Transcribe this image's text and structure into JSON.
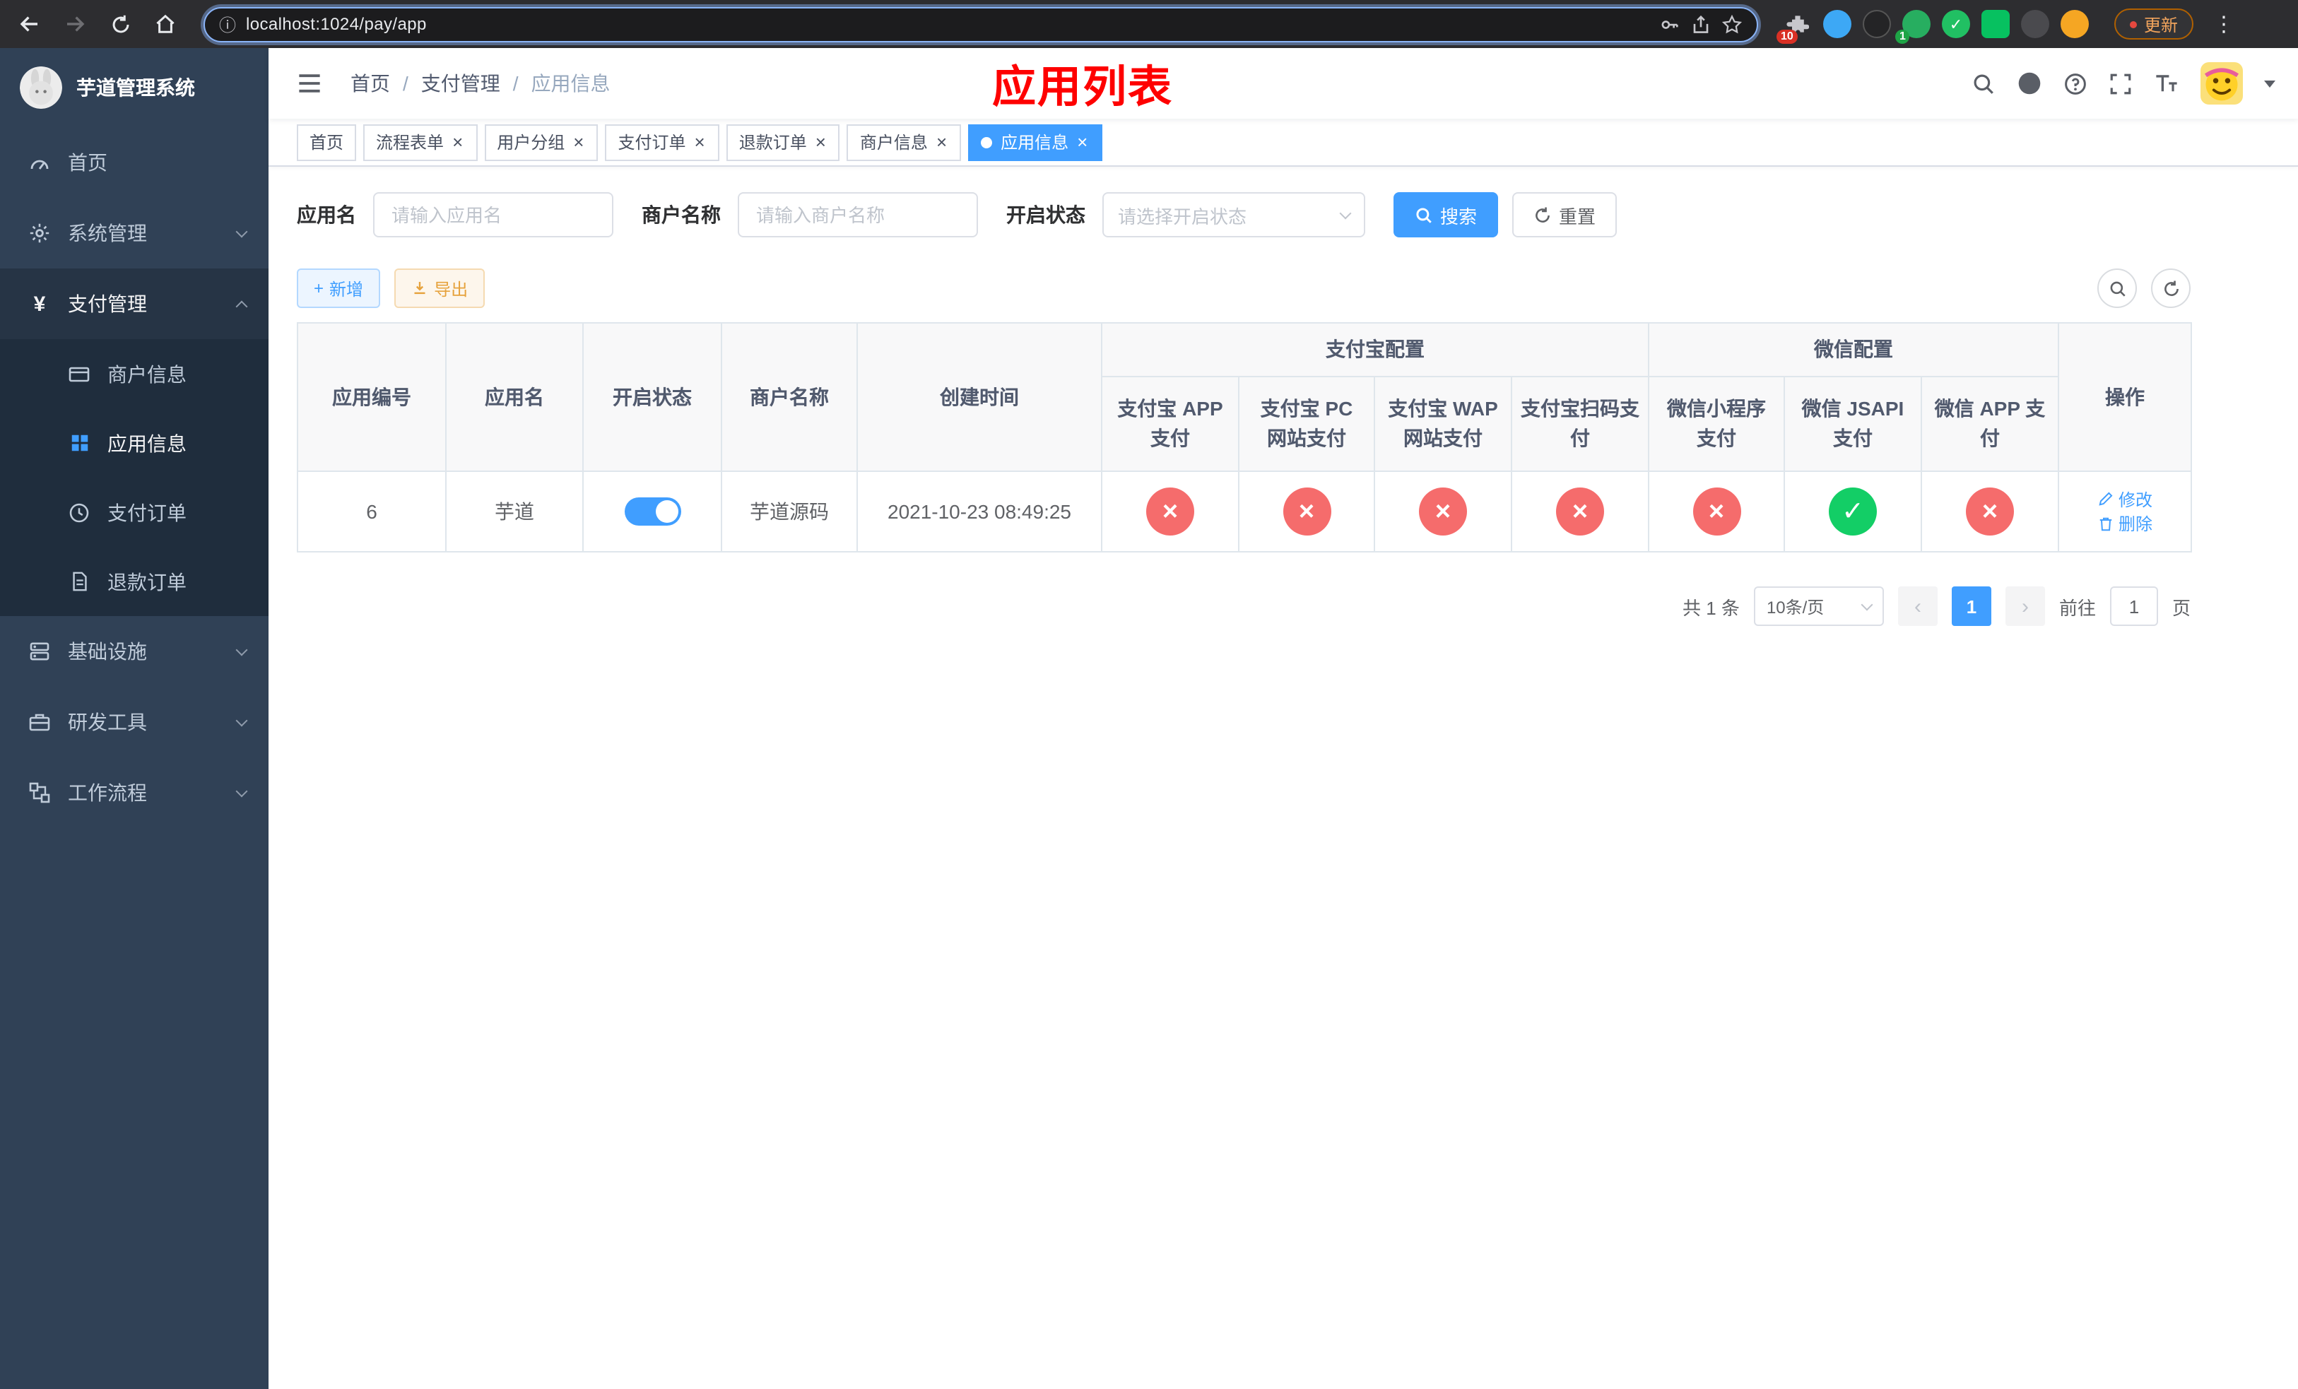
{
  "colors": {
    "primary": "#409eff",
    "success": "#13ce66",
    "danger": "#f56c6c",
    "warning": "#e6a23c",
    "sidebar_bg": "#304156",
    "submenu_bg": "#1f2d3d"
  },
  "icons": {
    "close": "×",
    "check": "✓",
    "cross": "×",
    "prev": "‹",
    "next": "›",
    "more_vertical": "⋮",
    "info": "ⓘ",
    "yen": "¥",
    "plus": "+"
  },
  "browser": {
    "url": "localhost:1024/pay/app",
    "update_label": "更新",
    "extension_badges": [
      "10",
      "1"
    ]
  },
  "sidebar": {
    "app_title": "芋道管理系统",
    "menu": [
      {
        "label": "首页"
      },
      {
        "label": "系统管理"
      },
      {
        "label": "支付管理",
        "children": [
          {
            "label": "商户信息"
          },
          {
            "label": "应用信息"
          },
          {
            "label": "支付订单"
          },
          {
            "label": "退款订单"
          }
        ]
      },
      {
        "label": "基础设施"
      },
      {
        "label": "研发工具"
      },
      {
        "label": "工作流程"
      }
    ]
  },
  "header": {
    "breadcrumb": [
      "首页",
      "支付管理",
      "应用信息"
    ],
    "separator": "/",
    "overlay_title": "应用列表"
  },
  "tabs": [
    {
      "label": "首页"
    },
    {
      "label": "流程表单"
    },
    {
      "label": "用户分组"
    },
    {
      "label": "支付订单"
    },
    {
      "label": "退款订单"
    },
    {
      "label": "商户信息"
    },
    {
      "label": "应用信息"
    }
  ],
  "filters": {
    "app_name": {
      "label": "应用名",
      "placeholder": "请输入应用名",
      "value": ""
    },
    "merchant_name": {
      "label": "商户名称",
      "placeholder": "请输入商户名称",
      "value": ""
    },
    "status": {
      "label": "开启状态",
      "placeholder": "请选择开启状态"
    },
    "search_label": "搜索",
    "reset_label": "重置"
  },
  "toolbar": {
    "add_label": "新增",
    "export_label": "导出"
  },
  "table": {
    "groups": {
      "alipay": "支付宝配置",
      "wechat": "微信配置"
    },
    "columns": [
      "应用编号",
      "应用名",
      "开启状态",
      "商户名称",
      "创建时间",
      "支付宝 APP 支付",
      "支付宝 PC 网站支付",
      "支付宝 WAP 网站支付",
      "支付宝扫码支付",
      "微信小程序支付",
      "微信 JSAPI 支付",
      "微信 APP 支付",
      "操作"
    ],
    "rows": [
      {
        "id": "6",
        "name": "芋道",
        "enabled": true,
        "merchant": "芋道源码",
        "created": "2021-10-23 08:49:25",
        "alipay_app": false,
        "alipay_pc": false,
        "alipay_wap": false,
        "alipay_qr": false,
        "wechat_mini": false,
        "wechat_jsapi": true,
        "wechat_app": false,
        "edit_label": "修改",
        "delete_label": "删除"
      }
    ]
  },
  "pagination": {
    "total": "共 1 条",
    "page_size": "10条/页",
    "current_page": "1",
    "goto_label": "前往",
    "goto_value": "1",
    "unit_label": "页"
  }
}
